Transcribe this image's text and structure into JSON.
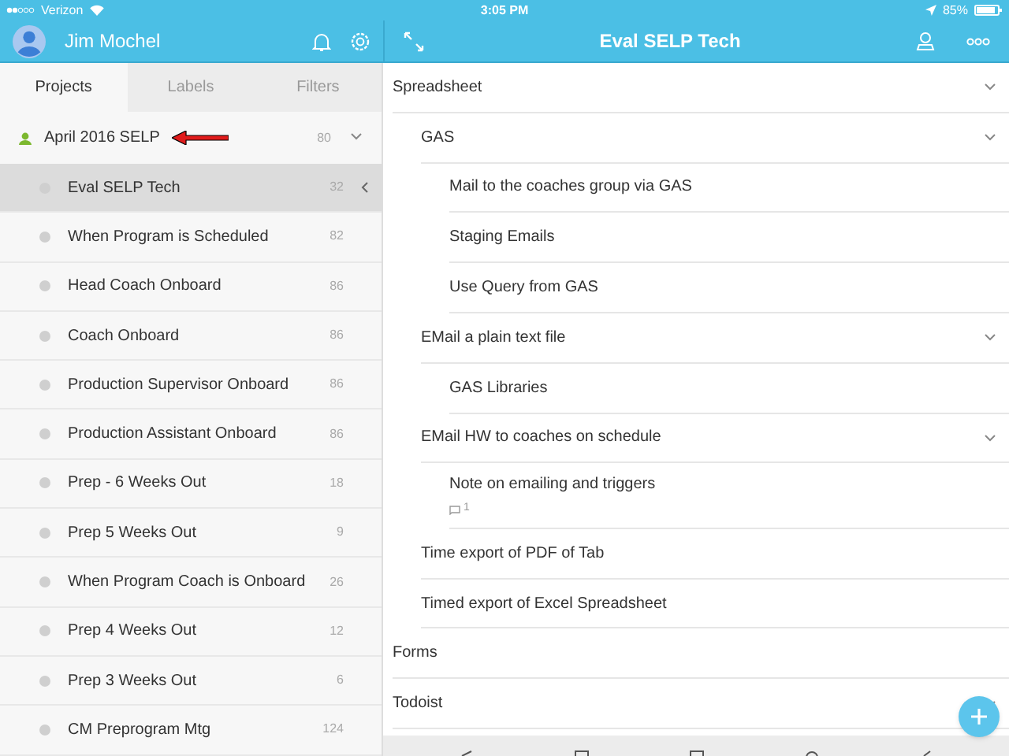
{
  "status_bar": {
    "carrier": "Verizon",
    "time": "3:05 PM",
    "battery": "85%"
  },
  "sidebar": {
    "user": "Jim Mochel",
    "tabs": [
      {
        "label": "Projects",
        "selected": true
      },
      {
        "label": "Labels",
        "selected": false
      },
      {
        "label": "Filters",
        "selected": false
      }
    ],
    "parent_project": {
      "name": "April 2016 SELP",
      "count": "80",
      "expanded": true,
      "color": "#7cb82f"
    },
    "projects": [
      {
        "name": "Eval SELP Tech",
        "count": "32",
        "selected": true
      },
      {
        "name": "When Program is Scheduled",
        "count": "82",
        "selected": false
      },
      {
        "name": "Head Coach Onboard",
        "count": "86",
        "selected": false
      },
      {
        "name": "Coach Onboard",
        "count": "86",
        "selected": false
      },
      {
        "name": "Production Supervisor Onboard",
        "count": "86",
        "selected": false
      },
      {
        "name": "Production Assistant Onboard",
        "count": "86",
        "selected": false
      },
      {
        "name": "Prep - 6 Weeks Out",
        "count": "18",
        "selected": false
      },
      {
        "name": "Prep 5 Weeks Out",
        "count": "9",
        "selected": false
      },
      {
        "name": "When Program Coach is Onboard",
        "count": "26",
        "selected": false
      },
      {
        "name": "Prep 4 Weeks Out",
        "count": "12",
        "selected": false
      },
      {
        "name": "Prep 3 Weeks Out",
        "count": "6",
        "selected": false
      },
      {
        "name": "CM Preprogram Mtg",
        "count": "124",
        "selected": false
      }
    ]
  },
  "main": {
    "title": "Eval SELP Tech",
    "tasks": [
      {
        "text": "Spreadsheet",
        "expanded": true,
        "children": [
          {
            "text": "GAS",
            "expanded": true,
            "children": [
              {
                "text": "Mail to the coaches group via GAS"
              },
              {
                "text": "Staging Emails"
              },
              {
                "text": "Use Query from GAS"
              }
            ]
          },
          {
            "text": "EMail a plain text file",
            "expanded": true,
            "children": [
              {
                "text": "GAS Libraries"
              }
            ]
          },
          {
            "text": "EMail HW to coaches on schedule",
            "expanded": true,
            "children": [
              {
                "text": "Note on emailing and triggers",
                "comments": "1"
              }
            ]
          },
          {
            "text": "Time export of PDF of Tab"
          },
          {
            "text": "Timed export of Excel Spreadsheet"
          }
        ]
      },
      {
        "text": "Forms"
      },
      {
        "text": "Todoist",
        "expanded": true
      }
    ]
  }
}
